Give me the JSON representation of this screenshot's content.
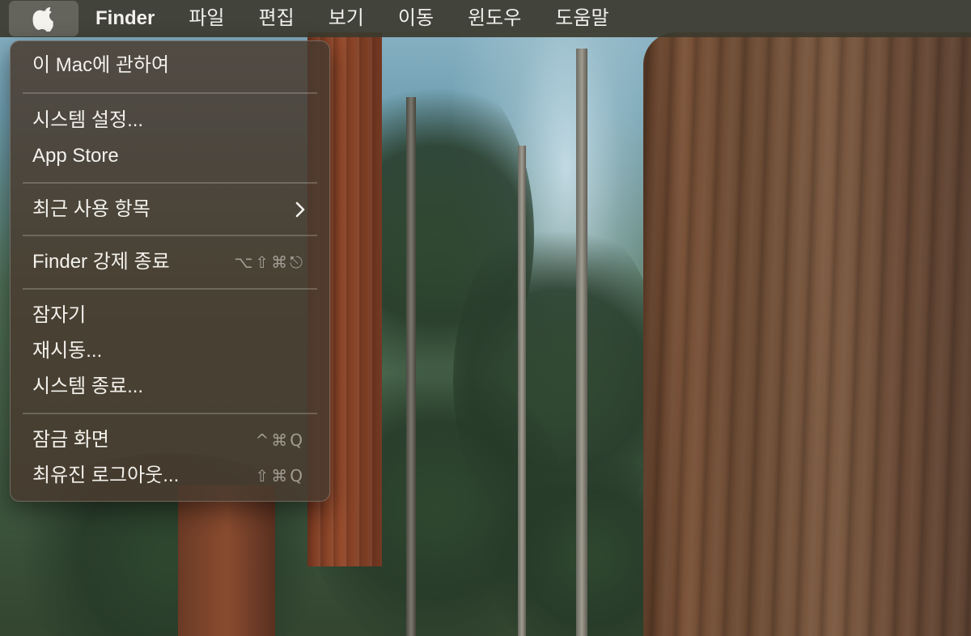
{
  "menubar": {
    "apple_icon": "apple-logo-icon",
    "app_name": "Finder",
    "menus": [
      "파일",
      "편집",
      "보기",
      "이동",
      "윈도우",
      "도움말"
    ]
  },
  "apple_menu": {
    "about": "이 Mac에 관하여",
    "system_settings": "시스템 설정...",
    "app_store": "App Store",
    "recent_items": "최근 사용 항목",
    "force_quit": "Finder 강제 종료",
    "force_quit_shortcut": "⌥⇧⌘⎋",
    "sleep": "잠자기",
    "restart": "재시동...",
    "shut_down": "시스템 종료...",
    "lock_screen": "잠금 화면",
    "lock_screen_shortcut": "^⌘Q",
    "log_out": "최유진 로그아웃...",
    "log_out_shortcut": "⇧⌘Q"
  },
  "colors": {
    "menubar_bg": "#3c3a2e",
    "menu_bg": "#483a2e",
    "text": "#f3f1ec"
  }
}
